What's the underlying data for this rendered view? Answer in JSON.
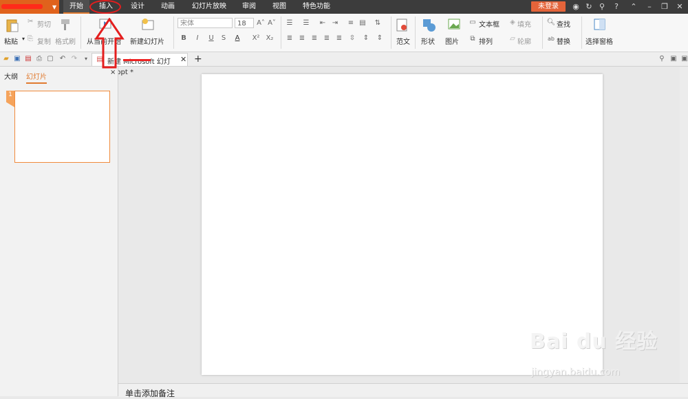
{
  "menubar": {
    "app_label": "WPS 演示",
    "tabs": [
      {
        "label": "开始",
        "active": true
      },
      {
        "label": "插入",
        "active": false
      },
      {
        "label": "设计",
        "active": false
      },
      {
        "label": "动画",
        "active": false
      },
      {
        "label": "幻灯片放映",
        "active": false
      },
      {
        "label": "审阅",
        "active": false
      },
      {
        "label": "视图",
        "active": false
      },
      {
        "label": "特色功能",
        "active": false
      }
    ],
    "login_label": "未登录",
    "help_label": "?"
  },
  "ribbon": {
    "paste": "粘贴",
    "cut": "剪切",
    "copy": "复制",
    "format_painter": "格式刷",
    "from_current": "从当前开始",
    "new_slide": "新建幻灯片",
    "font_name": "宋体",
    "font_size": "18",
    "template": "范文",
    "shape": "形状",
    "picture": "图片",
    "textbox": "文本框",
    "arrange": "排列",
    "fill": "填充",
    "outline": "轮廓",
    "find": "查找",
    "replace": "替换",
    "selection_pane": "选择窗格"
  },
  "document_tab": {
    "filename": "新建 Microsoft 幻灯片.ppt *"
  },
  "left_panel": {
    "tab_outline": "大纲",
    "tab_slides": "幻灯片",
    "slide_number": "1"
  },
  "notes_placeholder": "单击添加备注",
  "watermark": {
    "logo": "Bai du 经验",
    "url": "jingyan.baidu.com"
  },
  "colors": {
    "accent": "#e07a2f",
    "annotation": "#e41e1e",
    "menubar": "#3c3c3c"
  }
}
